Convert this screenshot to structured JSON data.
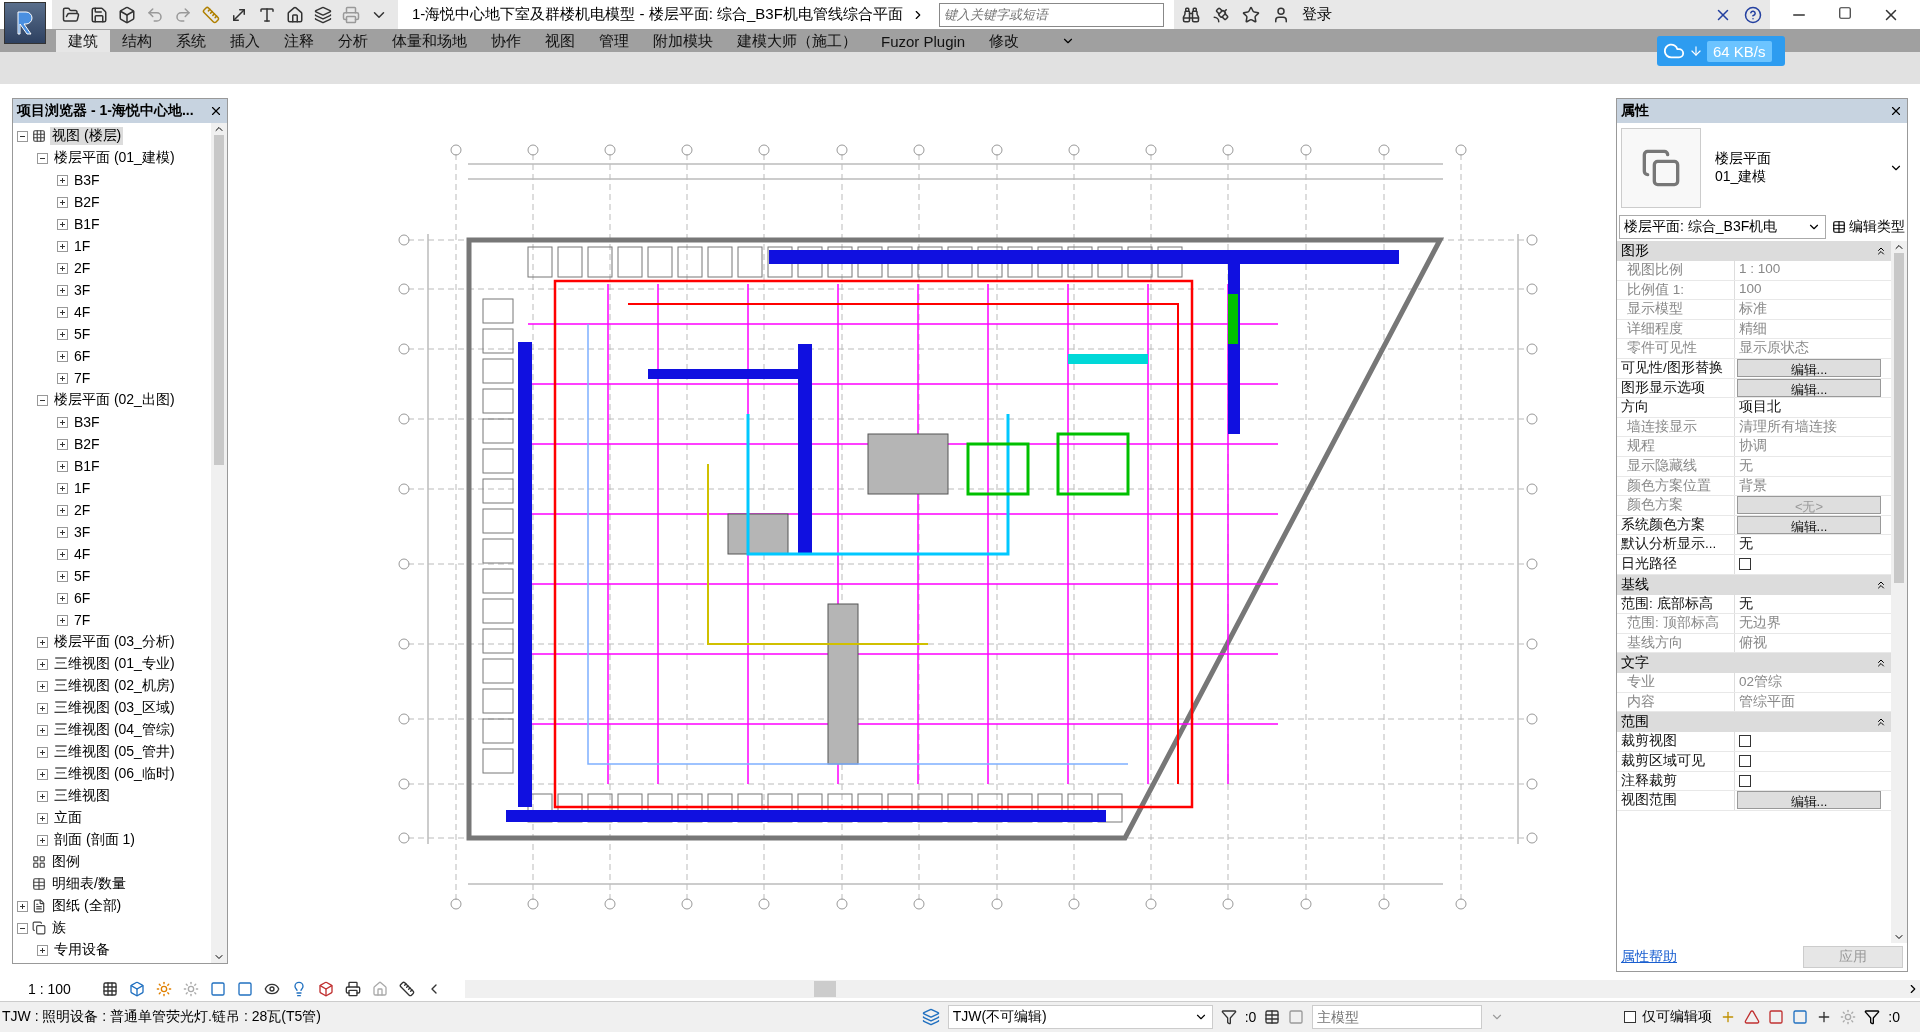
{
  "title_bar": {
    "title": "1-海悦中心地下室及群楼机电模型 - 楼层平面: 综合_B3F机电管线综合平面",
    "search": {
      "placeholder": "键入关键字或短语"
    },
    "login": "登录"
  },
  "ribbon": {
    "tabs": [
      {
        "label": "建筑",
        "selected": true
      },
      {
        "label": "结构",
        "selected": false
      },
      {
        "label": "系统",
        "selected": false
      },
      {
        "label": "插入",
        "selected": false
      },
      {
        "label": "注释",
        "selected": false
      },
      {
        "label": "分析",
        "selected": false
      },
      {
        "label": "体量和场地",
        "selected": false
      },
      {
        "label": "协作",
        "selected": false
      },
      {
        "label": "视图",
        "selected": false
      },
      {
        "label": "管理",
        "selected": false
      },
      {
        "label": "附加模块",
        "selected": false
      },
      {
        "label": "建模大师（施工）",
        "selected": false
      },
      {
        "label": "Fuzor Plugin",
        "selected": false
      },
      {
        "label": "修改",
        "selected": false
      }
    ]
  },
  "net_speed": "64 KB/s",
  "project_browser": {
    "title": "项目浏览器 - 1-海悦中心地...",
    "tree": [
      {
        "label": "视图 (楼层)",
        "kind": "views",
        "expanded": true,
        "selected": true,
        "children": [
          {
            "label": "楼层平面 (01_建模)",
            "expanded": true,
            "selected": false,
            "children": [
              {
                "label": "B3F",
                "expanded": false,
                "selected": false
              },
              {
                "label": "B2F",
                "expanded": false,
                "selected": false
              },
              {
                "label": "B1F",
                "expanded": false,
                "selected": false
              },
              {
                "label": "1F",
                "expanded": false,
                "selected": false
              },
              {
                "label": "2F",
                "expanded": false,
                "selected": false
              },
              {
                "label": "3F",
                "expanded": false,
                "selected": false
              },
              {
                "label": "4F",
                "expanded": false,
                "selected": false
              },
              {
                "label": "5F",
                "expanded": false,
                "selected": false
              },
              {
                "label": "6F",
                "expanded": false,
                "selected": false
              },
              {
                "label": "7F",
                "expanded": false,
                "selected": false
              }
            ]
          },
          {
            "label": "楼层平面 (02_出图)",
            "expanded": true,
            "selected": false,
            "children": [
              {
                "label": "B3F",
                "expanded": false,
                "selected": false
              },
              {
                "label": "B2F",
                "expanded": false,
                "selected": false
              },
              {
                "label": "B1F",
                "expanded": false,
                "selected": false
              },
              {
                "label": "1F",
                "expanded": false,
                "selected": false
              },
              {
                "label": "2F",
                "expanded": false,
                "selected": false
              },
              {
                "label": "3F",
                "expanded": false,
                "selected": false
              },
              {
                "label": "4F",
                "expanded": false,
                "selected": false
              },
              {
                "label": "5F",
                "expanded": false,
                "selected": false
              },
              {
                "label": "6F",
                "expanded": false,
                "selected": false
              },
              {
                "label": "7F",
                "expanded": false,
                "selected": false
              }
            ]
          },
          {
            "label": "楼层平面 (03_分析)",
            "expanded": false,
            "selected": false
          },
          {
            "label": "三维视图 (01_专业)",
            "expanded": false,
            "selected": false
          },
          {
            "label": "三维视图 (02_机房)",
            "expanded": false,
            "selected": false
          },
          {
            "label": "三维视图 (03_区域)",
            "expanded": false,
            "selected": false
          },
          {
            "label": "三维视图 (04_管综)",
            "expanded": false,
            "selected": false
          },
          {
            "label": "三维视图 (05_管井)",
            "expanded": false,
            "selected": false
          },
          {
            "label": "三维视图 (06_临时)",
            "expanded": false,
            "selected": false
          },
          {
            "label": "三维视图",
            "expanded": false,
            "selected": false
          },
          {
            "label": "立面",
            "expanded": false,
            "selected": false
          },
          {
            "label": "剖面 (剖面 1)",
            "expanded": false,
            "selected": false
          }
        ]
      },
      {
        "label": "图例",
        "kind": "legend",
        "selected": false
      },
      {
        "label": "明细表/数量",
        "kind": "schedule",
        "selected": false
      },
      {
        "label": "图纸 (全部)",
        "kind": "sheets",
        "expanded": false,
        "selected": false
      },
      {
        "label": "族",
        "kind": "family",
        "expanded": true,
        "selected": false,
        "children": [
          {
            "label": "专用设备",
            "expanded": false,
            "selected": false
          }
        ]
      }
    ]
  },
  "properties": {
    "title": "属性",
    "type_name": [
      "楼层平面",
      "01_建模"
    ],
    "view_selector": "楼层平面: 综合_B3F机电",
    "edit_type": "编辑类型",
    "groups": [
      {
        "name": "图形",
        "rows": [
          {
            "label": "视图比例",
            "kind": "text",
            "value": "1 : 100",
            "disabled": true
          },
          {
            "label": "比例值 1:",
            "kind": "text",
            "value": "100",
            "disabled": true
          },
          {
            "label": "显示模型",
            "kind": "text",
            "value": "标准",
            "disabled": true
          },
          {
            "label": "详细程度",
            "kind": "text",
            "value": "精细",
            "disabled": true
          },
          {
            "label": "零件可见性",
            "kind": "text",
            "value": "显示原状态",
            "disabled": true
          },
          {
            "label": "可见性/图形替换",
            "kind": "button",
            "value": "编辑...",
            "disabled": false
          },
          {
            "label": "图形显示选项",
            "kind": "button",
            "value": "编辑...",
            "disabled": false
          },
          {
            "label": "方向",
            "kind": "text",
            "value": "项目北",
            "disabled": false
          },
          {
            "label": "墙连接显示",
            "kind": "text",
            "value": "清理所有墙连接",
            "disabled": true
          },
          {
            "label": "规程",
            "kind": "text",
            "value": "协调",
            "disabled": true
          },
          {
            "label": "显示隐藏线",
            "kind": "text",
            "value": "无",
            "disabled": true
          },
          {
            "label": "颜色方案位置",
            "kind": "text",
            "value": "背景",
            "disabled": true
          },
          {
            "label": "颜色方案",
            "kind": "button",
            "value": "<无>",
            "disabled": true
          },
          {
            "label": "系统颜色方案",
            "kind": "button",
            "value": "编辑...",
            "disabled": false
          },
          {
            "label": "默认分析显示...",
            "kind": "text",
            "value": "无",
            "disabled": false
          },
          {
            "label": "日光路径",
            "kind": "checkbox",
            "checked": false,
            "disabled": false
          }
        ]
      },
      {
        "name": "基线",
        "rows": [
          {
            "label": "范围: 底部标高",
            "kind": "text",
            "value": "无",
            "disabled": false
          },
          {
            "label": "范围: 顶部标高",
            "kind": "text",
            "value": "无边界",
            "disabled": true
          },
          {
            "label": "基线方向",
            "kind": "text",
            "value": "俯视",
            "disabled": true
          }
        ]
      },
      {
        "name": "文字",
        "rows": [
          {
            "label": "专业",
            "kind": "text",
            "value": "02管综",
            "disabled": true
          },
          {
            "label": "内容",
            "kind": "text",
            "value": "管综平面",
            "disabled": true
          }
        ]
      },
      {
        "name": "范围",
        "rows": [
          {
            "label": "裁剪视图",
            "kind": "checkbox",
            "checked": false,
            "disabled": false
          },
          {
            "label": "裁剪区域可见",
            "kind": "checkbox",
            "checked": false,
            "disabled": false
          },
          {
            "label": "注释裁剪",
            "kind": "checkbox",
            "checked": false,
            "disabled": false
          },
          {
            "label": "视图范围",
            "kind": "button",
            "value": "编辑...",
            "disabled": false
          }
        ]
      }
    ],
    "help_link": "属性帮助",
    "apply": {
      "label": "应用",
      "disabled": true
    }
  },
  "view_bar": {
    "scale": "1 : 100"
  },
  "status_bar": {
    "message": "TJW : 照明设备 : 普通单管荧光灯.链吊 : 28瓦(T5管)",
    "workset": "TJW(不可编辑)",
    "selection_count": ":0",
    "design_option": {
      "placeholder": "主模型"
    },
    "editable_only": {
      "label": "仅可编辑项",
      "checked": false
    },
    "filter_count": ":0"
  }
}
